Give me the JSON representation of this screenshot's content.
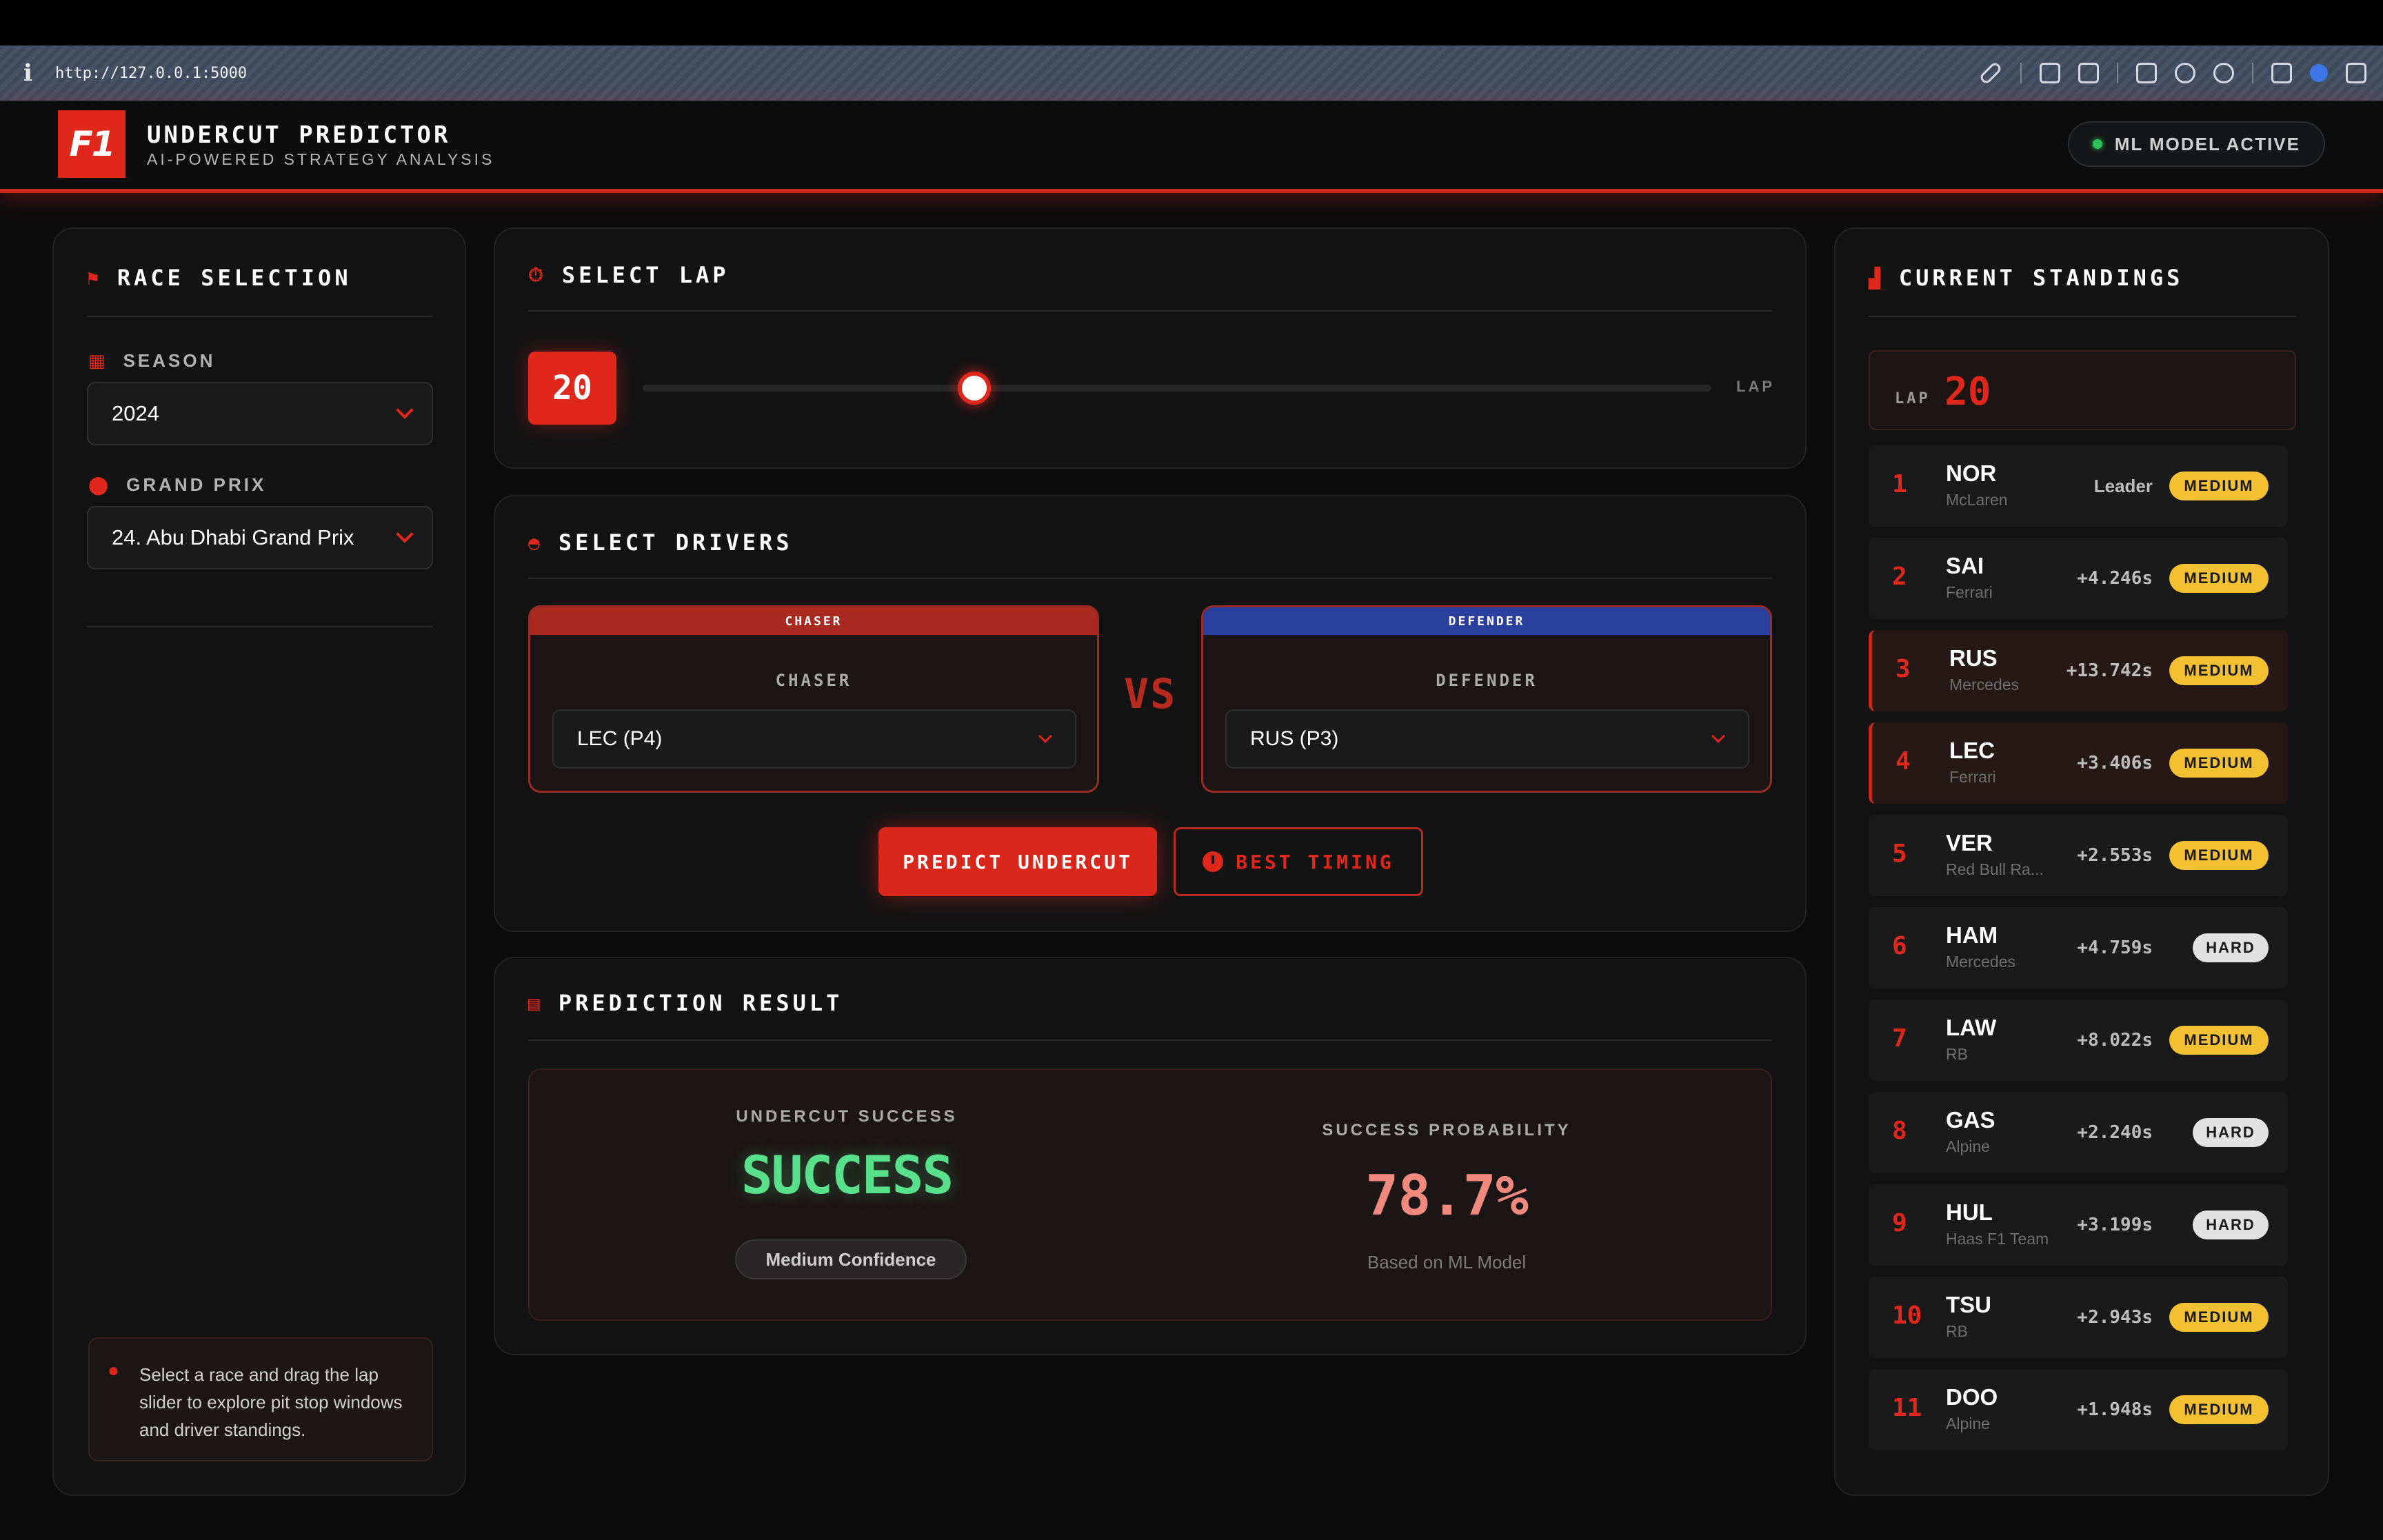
{
  "browser": {
    "url": "http://127.0.0.1:5000"
  },
  "header": {
    "logo_text": "F1",
    "title": "UNDERCUT PREDICTOR",
    "subtitle": "AI-POWERED STRATEGY ANALYSIS",
    "status": "ML MODEL ACTIVE",
    "status_color": "#2fbf5b"
  },
  "race_selection": {
    "title": "RACE SELECTION",
    "season_label": "SEASON",
    "season_value": "2024",
    "gp_label": "GRAND PRIX",
    "gp_value": "24. Abu Dhabi Grand Prix",
    "hint": "Select a race and drag the lap slider to explore pit stop windows and driver standings."
  },
  "select_lap": {
    "title": "SELECT LAP",
    "lap": "20",
    "unit": "LAP",
    "slider_fraction": 0.31
  },
  "select_drivers": {
    "title": "SELECT DRIVERS",
    "chaser": {
      "band": "CHASER",
      "label": "CHASER",
      "value": "LEC (P4)"
    },
    "vs": "VS",
    "defender": {
      "band": "DEFENDER",
      "label": "DEFENDER",
      "value": "RUS (P3)"
    },
    "predict_button": "PREDICT UNDERCUT",
    "timing_button": "BEST TIMING"
  },
  "prediction": {
    "title": "PREDICTION RESULT",
    "success_label": "UNDERCUT SUCCESS",
    "success_value": "SUCCESS",
    "confidence": "Medium Confidence",
    "prob_label": "SUCCESS PROBABILITY",
    "prob_value": "78.7%",
    "prob_sub": "Based on ML Model"
  },
  "standings": {
    "title": "CURRENT STANDINGS",
    "lap_label": "LAP",
    "lap_value": "20",
    "rows": [
      {
        "pos": "1",
        "code": "NOR",
        "team": "McLaren",
        "gap": "Leader",
        "tyre": "MEDIUM",
        "highlight": false
      },
      {
        "pos": "2",
        "code": "SAI",
        "team": "Ferrari",
        "gap": "+4.246s",
        "tyre": "MEDIUM",
        "highlight": false
      },
      {
        "pos": "3",
        "code": "RUS",
        "team": "Mercedes",
        "gap": "+13.742s",
        "tyre": "MEDIUM",
        "highlight": true
      },
      {
        "pos": "4",
        "code": "LEC",
        "team": "Ferrari",
        "gap": "+3.406s",
        "tyre": "MEDIUM",
        "highlight": true
      },
      {
        "pos": "5",
        "code": "VER",
        "team": "Red Bull Ra...",
        "gap": "+2.553s",
        "tyre": "MEDIUM",
        "highlight": false
      },
      {
        "pos": "6",
        "code": "HAM",
        "team": "Mercedes",
        "gap": "+4.759s",
        "tyre": "HARD",
        "highlight": false
      },
      {
        "pos": "7",
        "code": "LAW",
        "team": "RB",
        "gap": "+8.022s",
        "tyre": "MEDIUM",
        "highlight": false
      },
      {
        "pos": "8",
        "code": "GAS",
        "team": "Alpine",
        "gap": "+2.240s",
        "tyre": "HARD",
        "highlight": false
      },
      {
        "pos": "9",
        "code": "HUL",
        "team": "Haas F1 Team",
        "gap": "+3.199s",
        "tyre": "HARD",
        "highlight": false
      },
      {
        "pos": "10",
        "code": "TSU",
        "team": "RB",
        "gap": "+2.943s",
        "tyre": "MEDIUM",
        "highlight": false
      },
      {
        "pos": "11",
        "code": "DOO",
        "team": "Alpine",
        "gap": "+1.948s",
        "tyre": "MEDIUM",
        "highlight": false
      }
    ]
  },
  "colors": {
    "accent": "#e0271b",
    "success": "#58e08a",
    "medium_tyre": "#f3c032",
    "hard_tyre": "#e2e2e2"
  }
}
